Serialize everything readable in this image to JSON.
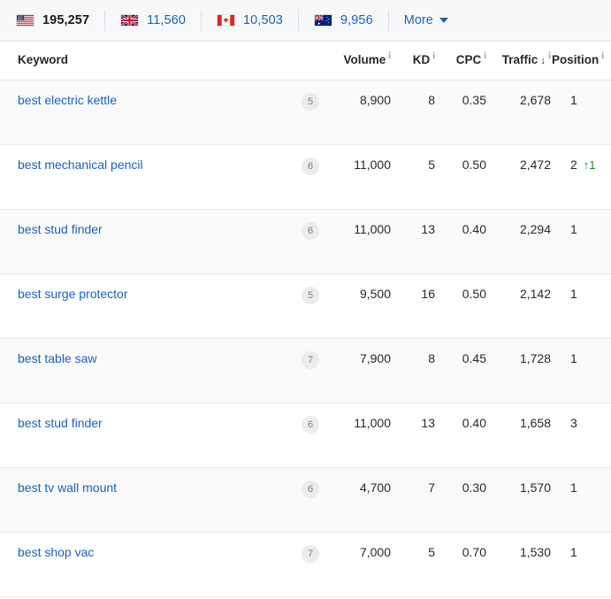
{
  "country_bar": {
    "items": [
      {
        "country": "United States",
        "flag": "us-flag-icon",
        "count": "195,257",
        "selected": true
      },
      {
        "country": "United Kingdom",
        "flag": "uk-flag-icon",
        "count": "11,560",
        "selected": false
      },
      {
        "country": "Canada",
        "flag": "ca-flag-icon",
        "count": "10,503",
        "selected": false
      },
      {
        "country": "Australia",
        "flag": "au-flag-icon",
        "count": "9,956",
        "selected": false
      }
    ],
    "more_label": "More",
    "more_caret": "chevron-down-icon"
  },
  "table": {
    "columns": [
      {
        "key": "keyword",
        "label": "Keyword",
        "info": false,
        "sorted": false
      },
      {
        "key": "serp",
        "label": "",
        "info": false,
        "sorted": false
      },
      {
        "key": "volume",
        "label": "Volume",
        "info": true,
        "sorted": false
      },
      {
        "key": "kd",
        "label": "KD",
        "info": true,
        "sorted": false
      },
      {
        "key": "cpc",
        "label": "CPC",
        "info": true,
        "sorted": false
      },
      {
        "key": "traffic",
        "label": "Traffic",
        "info": true,
        "sorted": true,
        "sort_arrow": "↓"
      },
      {
        "key": "position",
        "label": "Position",
        "info": true,
        "sorted": false
      }
    ],
    "info_glyph": "i",
    "rows": [
      {
        "keyword": "best electric kettle",
        "serp": "5",
        "volume": "8,900",
        "kd": "8",
        "cpc": "0.35",
        "traffic": "2,678",
        "position": "1",
        "position_change": ""
      },
      {
        "keyword": "best mechanical pencil",
        "serp": "6",
        "volume": "11,000",
        "kd": "5",
        "cpc": "0.50",
        "traffic": "2,472",
        "position": "2",
        "position_change": "↑1"
      },
      {
        "keyword": "best stud finder",
        "serp": "6",
        "volume": "11,000",
        "kd": "13",
        "cpc": "0.40",
        "traffic": "2,294",
        "position": "1",
        "position_change": ""
      },
      {
        "keyword": "best surge protector",
        "serp": "5",
        "volume": "9,500",
        "kd": "16",
        "cpc": "0.50",
        "traffic": "2,142",
        "position": "1",
        "position_change": ""
      },
      {
        "keyword": "best table saw",
        "serp": "7",
        "volume": "7,900",
        "kd": "8",
        "cpc": "0.45",
        "traffic": "1,728",
        "position": "1",
        "position_change": ""
      },
      {
        "keyword": "best stud finder",
        "serp": "6",
        "volume": "11,000",
        "kd": "13",
        "cpc": "0.40",
        "traffic": "1,658",
        "position": "3",
        "position_change": ""
      },
      {
        "keyword": "best tv wall mount",
        "serp": "6",
        "volume": "4,700",
        "kd": "7",
        "cpc": "0.30",
        "traffic": "1,570",
        "position": "1",
        "position_change": ""
      },
      {
        "keyword": "best shop vac",
        "serp": "7",
        "volume": "7,000",
        "kd": "5",
        "cpc": "0.70",
        "traffic": "1,530",
        "position": "1",
        "position_change": ""
      }
    ]
  },
  "colors": {
    "link": "#1a62b8",
    "text": "#26282c",
    "positive_change": "#2e7d32",
    "bar_background": "#f7f8fa",
    "row_shaded": "#fafafa",
    "badge_background": "#ececec"
  }
}
